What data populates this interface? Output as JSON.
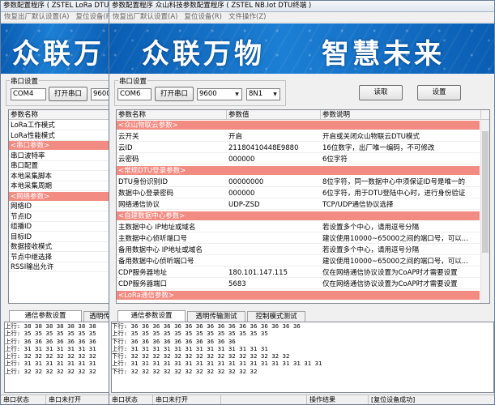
{
  "back": {
    "title": "参数配置程序 ( ZSTEL LoRa DTU )",
    "menu": [
      "恢复出厂默认设置(A)",
      "复位设备(R)"
    ],
    "banner": "众联万",
    "serial_group": "串口设置",
    "port": "COM4",
    "open_button": "打开串口",
    "baud": "9600",
    "grid_header": "参数名称",
    "rows": [
      {
        "name": "LoRa工作模式",
        "type": "item"
      },
      {
        "name": "LoRa性能模式",
        "type": "item"
      },
      {
        "name": "<串口参数>",
        "type": "section"
      },
      {
        "name": "串口波特率",
        "type": "item"
      },
      {
        "name": "串口配置",
        "type": "item"
      },
      {
        "name": "本地采集脚本",
        "type": "item"
      },
      {
        "name": "本地采集周期",
        "type": "item"
      },
      {
        "name": "<网络参数>",
        "type": "section"
      },
      {
        "name": "网络ID",
        "type": "item"
      },
      {
        "name": "节点ID",
        "type": "item"
      },
      {
        "name": "组播ID",
        "type": "item"
      },
      {
        "name": "目标ID",
        "type": "item"
      },
      {
        "name": "数据接收模式",
        "type": "item"
      },
      {
        "name": "节点中继选择",
        "type": "item"
      },
      {
        "name": "RSSI输出允许",
        "type": "item"
      }
    ],
    "tabs": [
      "通信参数设置",
      "透明传"
    ],
    "log": [
      "上行: 38 38 38 38 38 38 38",
      "上行: 35 35 35 35 35 35 35",
      "上行: 36 36 36 36 36 36 36",
      "上行: 31 31 31 31 31 31 31",
      "上行: 32 32 32 32 32 32 32",
      "上行: 31 31 31 31 31 31 31",
      "上行: 32 32 32 32 32 32 32"
    ],
    "status": [
      "串口状态",
      "串口未打开"
    ]
  },
  "front": {
    "title": "参数配置程序 众山科技参数配置程序 ( ZSTEL NB.Iot DTU终端 )",
    "menu": [
      "恢复出厂默认设置(A)",
      "复位设备(R)",
      "文件操作(Z)"
    ],
    "banner_left": "众联万物",
    "banner_right": "智慧未来",
    "serial_group": "串口设置",
    "port": "COM6",
    "open_button": "打开串口",
    "baud": "9600",
    "format": "8N1",
    "read_button": "读取",
    "set_button": "设置",
    "columns": [
      "参数名称",
      "参数值",
      "参数说明"
    ],
    "rows": [
      {
        "type": "section",
        "name": "<众山物联云参数>",
        "value": "",
        "desc": ""
      },
      {
        "type": "item",
        "name": "云开关",
        "value": "开启",
        "desc": "开启或关闭众山物联云DTU模式"
      },
      {
        "type": "item",
        "name": "云ID",
        "value": "21180410448E9880",
        "desc": "16位数字，出厂唯一编码，不可修改"
      },
      {
        "type": "item",
        "name": "云密码",
        "value": "000000",
        "desc": "6位字符"
      },
      {
        "type": "section",
        "name": "<常规DTU登录参数>",
        "value": "",
        "desc": ""
      },
      {
        "type": "item",
        "name": "DTU身份识别ID",
        "value": "00000000",
        "desc": "8位字符，同一数据中心中须保证ID号是唯一的"
      },
      {
        "type": "item",
        "name": "数据中心登录密码",
        "value": "000000",
        "desc": "6位字符，用于DTU登陆中心时，进行身份验证"
      },
      {
        "type": "item",
        "name": "网络通信协议",
        "value": "UDP-ZSD",
        "desc": "TCP/UDP通信协议选择"
      },
      {
        "type": "section",
        "name": "<自建数据中心参数>",
        "value": "",
        "desc": ""
      },
      {
        "type": "item",
        "name": "主数据中心 IP地址或域名",
        "value": "",
        "desc": "若设置多个中心，请用逗号分隔"
      },
      {
        "type": "item",
        "name": "主数据中心侦听端口号",
        "value": "",
        "desc": "建议使用10000~65000之间的端口号，可以..."
      },
      {
        "type": "item",
        "name": "备用数据中心 IP地址或域名",
        "value": "",
        "desc": "若设置多个中心，请用逗号分隔"
      },
      {
        "type": "item",
        "name": "备用数据中心侦听端口号",
        "value": "",
        "desc": "建议使用10000~65000之间的端口号，可以..."
      },
      {
        "type": "item",
        "name": "CDP服务器地址",
        "value": "180.101.147.115",
        "desc": "仅在网络通信协议设置为CoAP时才需要设置"
      },
      {
        "type": "item",
        "name": "CDP服务器端口",
        "value": "5683",
        "desc": "仅在网络通信协议设置为CoAP时才需要设置"
      },
      {
        "type": "section",
        "name": "<LoRa通信参数>",
        "value": "",
        "desc": ""
      }
    ],
    "tabs": [
      "通信参数设置",
      "透明传输测试",
      "控制模式测试"
    ],
    "log": [
      "下行: 36 36 36 36 36 36 36 36 36 36 36 36 36 36 36 36",
      "上行: 35 35 35 35 35 35 35 35 35 35 35 35 35",
      "下行: 36 36 36 36 36 36 36 36 36 36",
      "上行: 31 31 31 31 31 31 31 31 31 31 31 31 31",
      "下行: 32 32 32 32 32 32 32 32 32 32 32 32 32 32 32",
      "上行: 31 31 31 31 31 31 31 31 31 31 31 31 31 31 31 31 31 31",
      "下行: 32 32 32 32 32 32 32 32 32 32 32 32"
    ],
    "status": [
      "串口状态",
      "串口未打开",
      "",
      "操作结果",
      "[复位设备成功]"
    ]
  }
}
